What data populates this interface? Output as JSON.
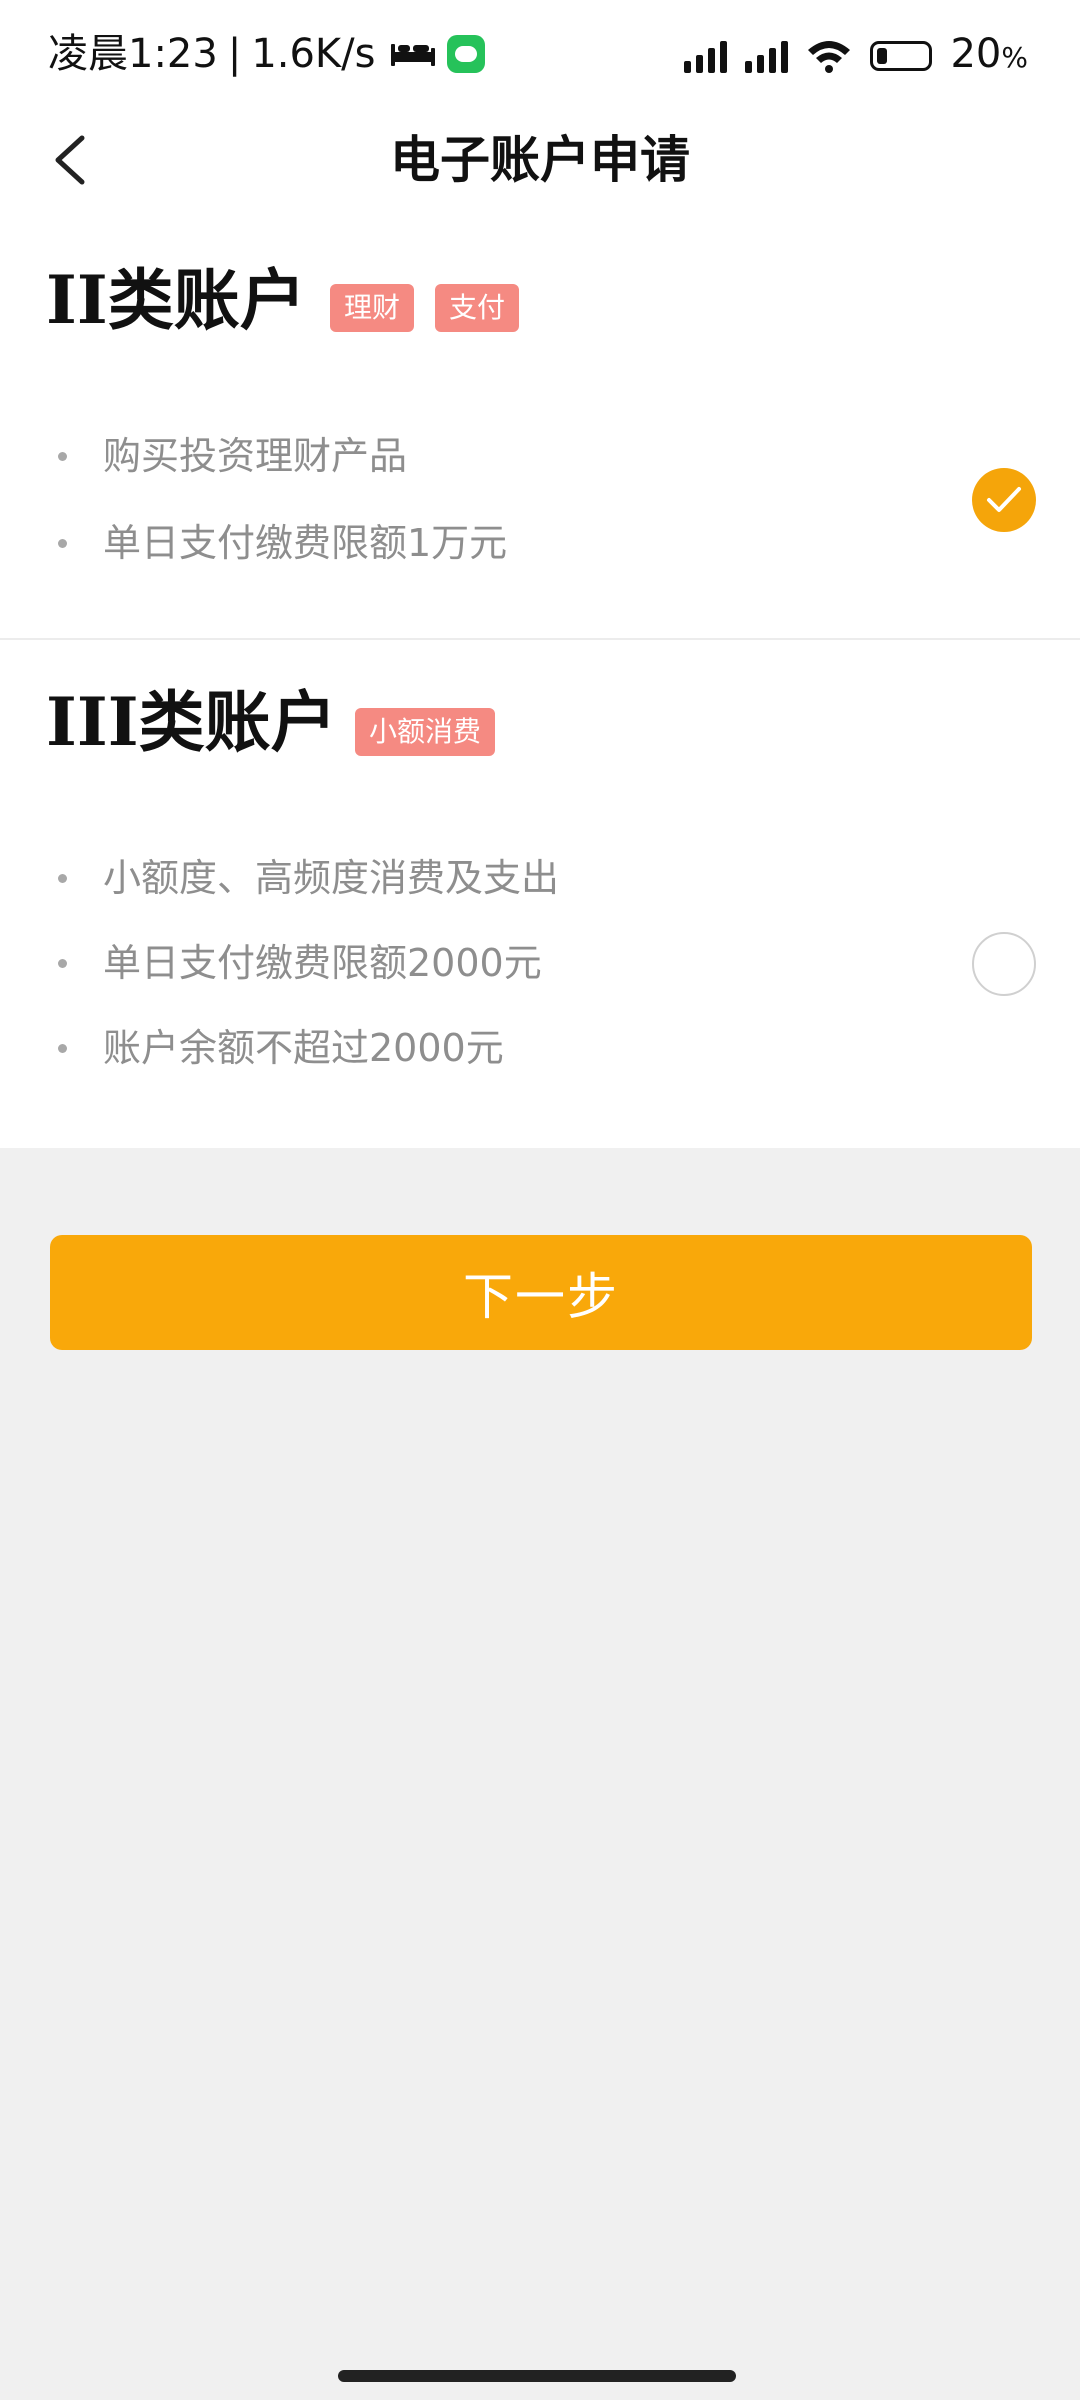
{
  "status_bar": {
    "time": "凌晨1:23",
    "separator": "|",
    "speed": "1.6K/s",
    "battery_percent": "20",
    "battery_unit": "%",
    "icons": [
      "bed-icon",
      "message-icon",
      "signal-icon",
      "signal-icon",
      "wifi-icon",
      "battery-icon"
    ]
  },
  "header": {
    "title": "电子账户申请",
    "back_icon": "chevron-left-icon"
  },
  "accounts": [
    {
      "title": "II类账户",
      "tags": [
        "理财",
        "支付"
      ],
      "features": [
        "购买投资理财产品",
        "单日支付缴费限额1万元"
      ],
      "selected": true
    },
    {
      "title": "III类账户",
      "tags": [
        "小额消费"
      ],
      "features": [
        "小额度、高频度消费及支出",
        "单日支付缴费限额2000元",
        "账户余额不超过2000元"
      ],
      "selected": false
    }
  ],
  "actions": {
    "next_label": "下一步"
  },
  "colors": {
    "accent": "#f9a80a",
    "tag": "#f58a82",
    "feature_text": "#8e8e8e",
    "page_bg": "#f0f0f0"
  }
}
